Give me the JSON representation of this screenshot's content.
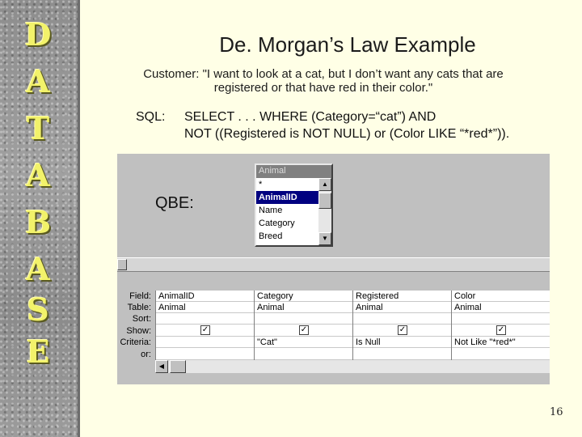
{
  "sidebar": {
    "letters": [
      "D",
      "A",
      "T",
      "A",
      "B",
      "A",
      "S",
      "E"
    ]
  },
  "slide": {
    "title": "De. Morgan’s Law Example",
    "quote_line1": "Customer: \"I want to look at a cat, but I don’t want any cats that are",
    "quote_line2": "registered or that have red in their color.\"",
    "sql_label": "SQL:",
    "sql_line1": "SELECT . . . WHERE (Category=“cat”) AND",
    "sql_line2": "NOT ((Registered is NOT NULL) or (Color LIKE “*red*”)).",
    "qbe_label": "QBE:",
    "page_number": "16"
  },
  "field_list": {
    "title": "Animal",
    "items": [
      "*",
      "AnimalID",
      "Name",
      "Category",
      "Breed"
    ],
    "selected": "AnimalID"
  },
  "grid": {
    "row_labels": [
      "Field:",
      "Table:",
      "Sort:",
      "Show:",
      "Criteria:",
      "or:"
    ],
    "columns": [
      {
        "field": "AnimalID",
        "table": "Animal",
        "sort": "",
        "show": true,
        "criteria": "",
        "or": ""
      },
      {
        "field": "Category",
        "table": "Animal",
        "sort": "",
        "show": true,
        "criteria": "\"Cat\"",
        "or": ""
      },
      {
        "field": "Registered",
        "table": "Animal",
        "sort": "",
        "show": true,
        "criteria": "Is Null",
        "or": ""
      },
      {
        "field": "Color",
        "table": "Animal",
        "sort": "",
        "show": true,
        "criteria": "Not Like \"*red*\"",
        "or": ""
      }
    ]
  },
  "colors": {
    "background": "#ffffe6",
    "letters": "#f2f26a",
    "selection": "#000080",
    "window": "#c0c0c0"
  }
}
